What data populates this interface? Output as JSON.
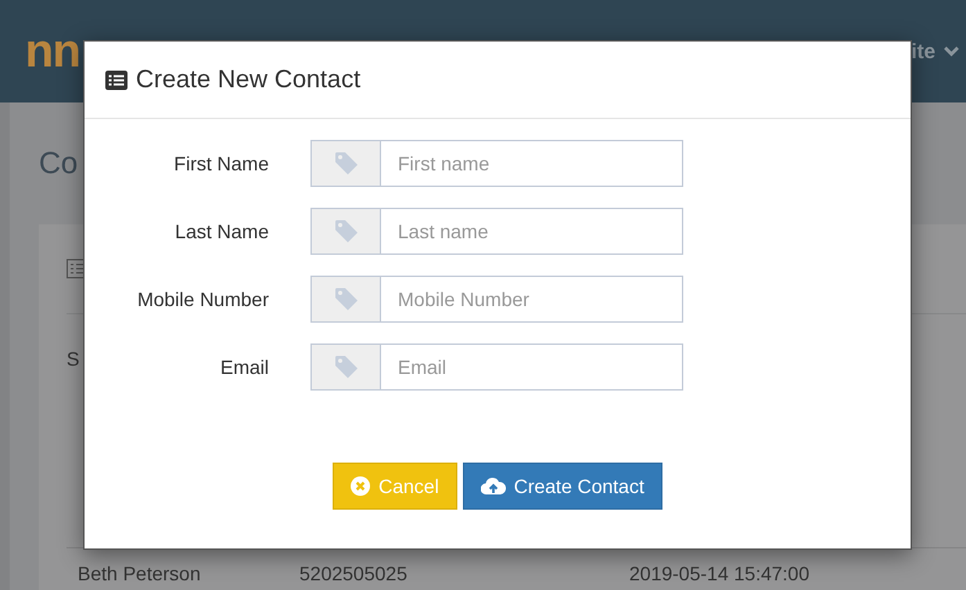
{
  "background": {
    "logo": "nn",
    "user_menu": "ite",
    "page_title": "Co",
    "panel_text": "S",
    "rows": [
      {
        "name": "Beth Peterson",
        "mobile": "5202505025",
        "created": "2019-05-14 15:47:00"
      }
    ]
  },
  "dialog": {
    "title": "Create New Contact",
    "fields": [
      {
        "label": "First Name",
        "placeholder": "First name"
      },
      {
        "label": "Last Name",
        "placeholder": "Last name"
      },
      {
        "label": "Mobile Number",
        "placeholder": "Mobile Number"
      },
      {
        "label": "Email",
        "placeholder": "Email"
      }
    ],
    "buttons": [
      {
        "kind": "cancel",
        "label": "Cancel"
      },
      {
        "kind": "submit",
        "label": "Create Contact"
      }
    ]
  }
}
